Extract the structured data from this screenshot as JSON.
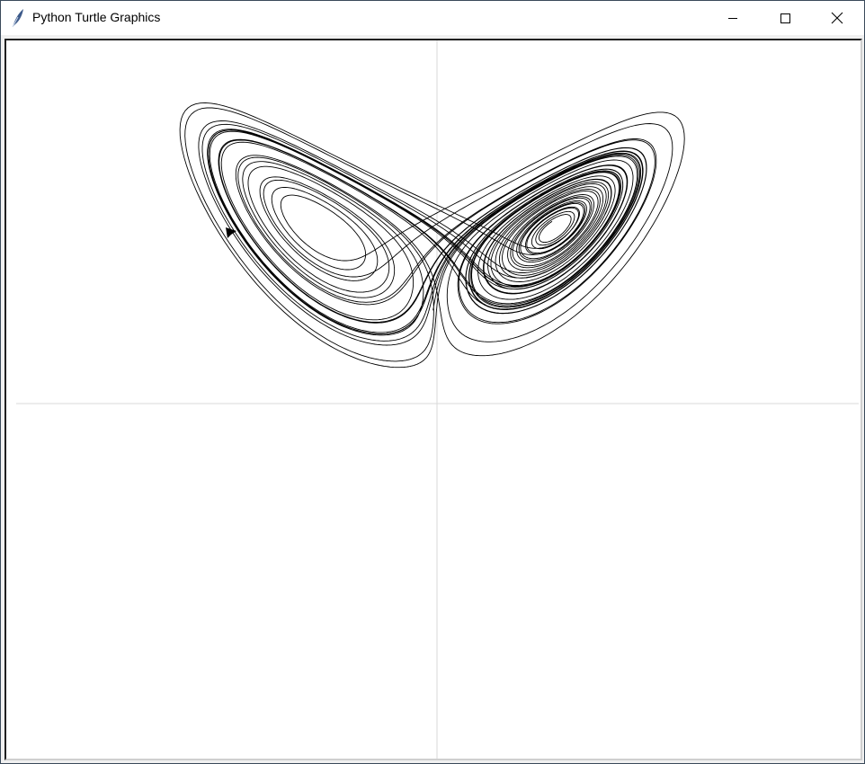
{
  "window": {
    "title": "Python Turtle Graphics",
    "icon": "feather-icon"
  },
  "controls": {
    "minimize": "minimize-icon",
    "maximize": "maximize-icon",
    "close": "close-icon"
  },
  "canvas": {
    "background": "#ffffff",
    "line_color": "#000000",
    "axis_color": "#d9d9d9",
    "drawing": "lorenz-attractor"
  }
}
